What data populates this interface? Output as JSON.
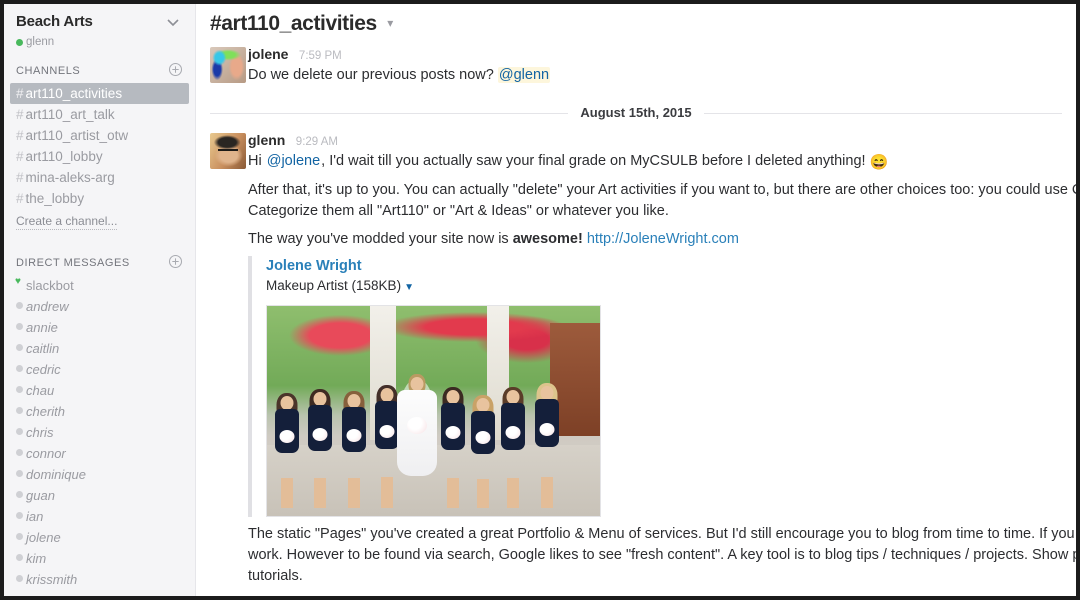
{
  "sidebar": {
    "team_name": "Beach Arts",
    "team_chevron_icon": "chevron-down-icon",
    "current_user": "glenn",
    "channels_header": "CHANNELS",
    "channels_add_icon": "plus-circle-icon",
    "channels": [
      {
        "name": "art110_activities",
        "active": true
      },
      {
        "name": "art110_art_talk",
        "active": false
      },
      {
        "name": "art110_artist_otw",
        "active": false
      },
      {
        "name": "art110_lobby",
        "active": false
      },
      {
        "name": "mina-aleks-arg",
        "active": false
      },
      {
        "name": "the_lobby",
        "active": false
      }
    ],
    "create_channel_label": "Create a channel...",
    "dm_header": "DIRECT MESSAGES",
    "dm_add_icon": "plus-circle-icon",
    "dms": [
      {
        "name": "slackbot",
        "presence": "bot"
      },
      {
        "name": "andrew",
        "presence": "away"
      },
      {
        "name": "annie",
        "presence": "away"
      },
      {
        "name": "caitlin",
        "presence": "away"
      },
      {
        "name": "cedric",
        "presence": "away"
      },
      {
        "name": "chau",
        "presence": "away"
      },
      {
        "name": "cherith",
        "presence": "away"
      },
      {
        "name": "chris",
        "presence": "away"
      },
      {
        "name": "connor",
        "presence": "away"
      },
      {
        "name": "dominique",
        "presence": "away"
      },
      {
        "name": "guan",
        "presence": "away"
      },
      {
        "name": "ian",
        "presence": "away"
      },
      {
        "name": "jolene",
        "presence": "away"
      },
      {
        "name": "kim",
        "presence": "away"
      },
      {
        "name": "krissmith",
        "presence": "away"
      }
    ]
  },
  "main": {
    "channel_title_hash": "#",
    "channel_title": "art110_activities",
    "channel_caret_icon": "chevron-down-icon",
    "date_divider": "August 15th, 2015",
    "messages": [
      {
        "user": "jolene",
        "time": "7:59 PM",
        "avatar": "jolene-avatar",
        "text_before": "Do we delete our previous posts now? ",
        "mention": "@glenn"
      },
      {
        "user": "glenn",
        "time": "9:29 AM",
        "avatar": "glenn-avatar",
        "p1_a": "Hi ",
        "p1_mention": "@jolene",
        "p1_b": ", I'd wait till you actually saw your final grade on MyCSULB before I deleted anything! ",
        "p1_emoji": "😄",
        "p2": "After that, it's up to you. You can actually \"delete\" your Art activities if you want to, but there are other choices too: you could  use CATEGORIES... might Categorize them all \"Art110\" or \"Art & Ideas\" or whatever you like.",
        "p3_a": "The way you've modded your site now is ",
        "p3_bold": "awesome!",
        "p3_link": "http://JoleneWright.com",
        "attachment": {
          "title": "Jolene Wright",
          "subtitle": "Makeup Artist (158KB)",
          "caret_icon": "caret-down-icon",
          "image_alt": "wedding-party-photo"
        },
        "p4": "The static \"Pages\" you've created a great Portfolio & Menu of services. But I'd still encourage you to blog from time to time. If you give someone a great work. However to be found via search, Google likes to see \"fresh content\". A key tool is to blog tips / techniques / projects. Show people what you do with tutorials."
      }
    ]
  },
  "colors": {
    "accent_link": "#2a80b9",
    "mention_bg": "#fdf6dc",
    "active_channel_bg": "#b6bac0",
    "sidebar_bg": "#f5f5f7",
    "presence_online": "#49b95d"
  }
}
